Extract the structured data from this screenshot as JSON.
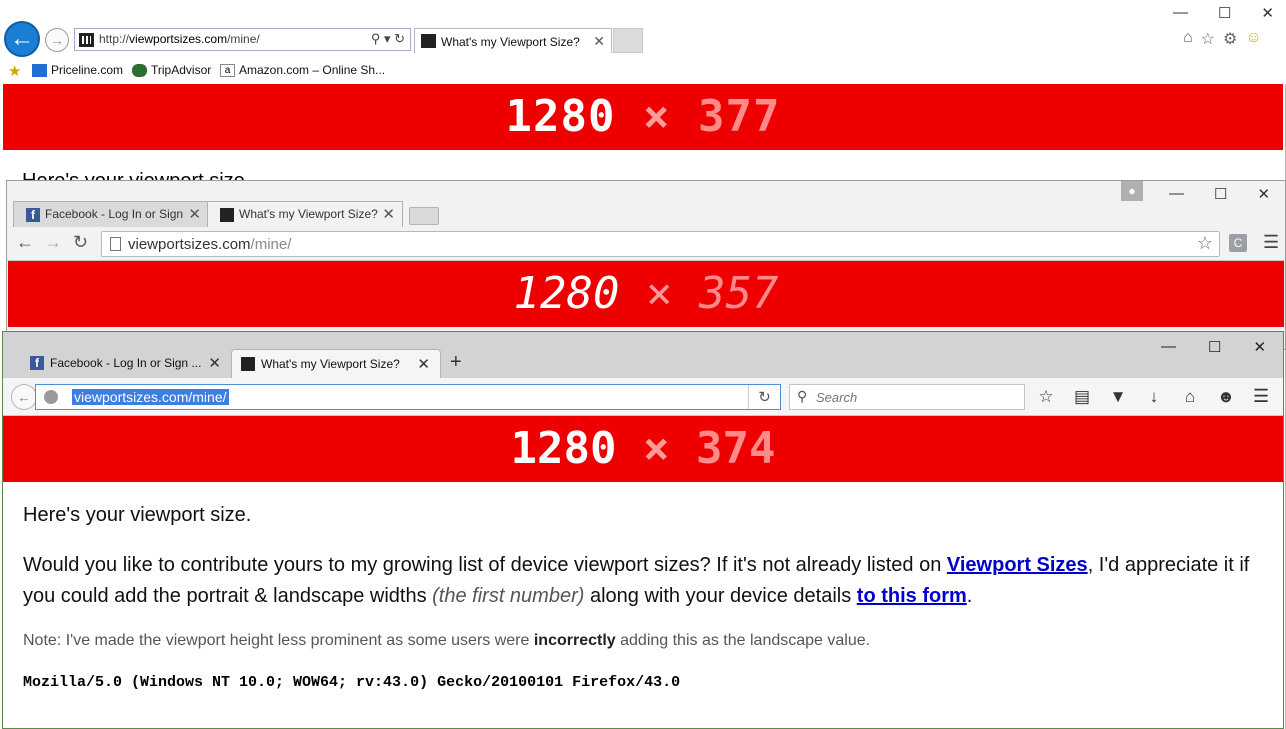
{
  "ie": {
    "address_scheme": "http://",
    "address_domain": "viewportsizes.com",
    "address_path": "/mine/",
    "tab_title": "What's my Viewport Size?",
    "favorites": [
      "Priceline.com",
      "TripAdvisor",
      "Amazon.com – Online Sh..."
    ],
    "banner": {
      "width": "1280",
      "x": "×",
      "height": "377"
    },
    "peek_text": "Here's your viewport size."
  },
  "chrome": {
    "tabs": [
      "Facebook - Log In or Sign Up",
      "What's my Viewport Size?"
    ],
    "url_domain": "viewportsizes.com",
    "url_path": "/mine/",
    "ext_letter": "C",
    "banner": {
      "width": "1280",
      "x": "×",
      "height": "357"
    }
  },
  "firefox": {
    "tabs": [
      "Facebook - Log In or Sign ...",
      "What's my Viewport Size?"
    ],
    "url": "viewportsizes.com/mine/",
    "search_placeholder": "Search",
    "banner": {
      "width": "1280",
      "x": "×",
      "height": "374"
    },
    "content": {
      "lead": "Here's your viewport size.",
      "p1_a": "Would you like to contribute yours to my growing list of device viewport sizes? If it's not already listed on ",
      "p1_link1": "Viewport Sizes",
      "p1_b": ", I'd appreciate it if you could add the portrait & landscape widths ",
      "p1_em": "(the first number)",
      "p1_c": " along with your device details ",
      "p1_link2": "to this form",
      "p1_d": ".",
      "note_a": "Note: I've made the viewport height less prominent as some users were ",
      "note_b": "incorrectly",
      "note_c": " adding this as the landscape value.",
      "user_agent": "Mozilla/5.0 (Windows NT 10.0; WOW64; rv:43.0) Gecko/20100101 Firefox/43.0"
    }
  },
  "colors": {
    "banner_red": "#ee0000",
    "link_blue": "#0000cc"
  }
}
